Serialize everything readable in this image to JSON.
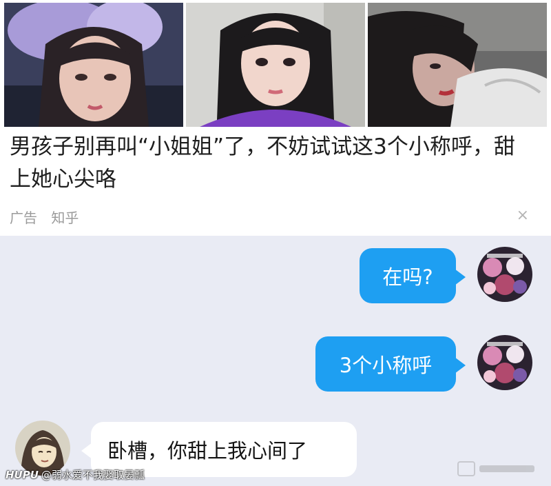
{
  "ad": {
    "images": [
      {
        "label": "ad-photo-1"
      },
      {
        "label": "ad-photo-2"
      },
      {
        "label": "ad-photo-3"
      }
    ],
    "title": "男孩子别再叫“小姐姐”了，不妨试试这3个小称呼，甜上她心尖咯",
    "tag": "广告",
    "source": "知乎",
    "close_icon": "×"
  },
  "chat": {
    "messages": [
      {
        "side": "right",
        "text": "在吗?"
      },
      {
        "side": "right",
        "text": "3个小称呼"
      },
      {
        "side": "left",
        "text": "卧槽，你甜上我心间了"
      }
    ]
  },
  "watermark": {
    "brand": "HUPU",
    "user": "@弱水爱不我娶取晏瓢"
  },
  "colors": {
    "chat_background": "#e9ebf4",
    "outgoing_bubble": "#1e9ff2",
    "incoming_bubble": "#ffffff"
  }
}
